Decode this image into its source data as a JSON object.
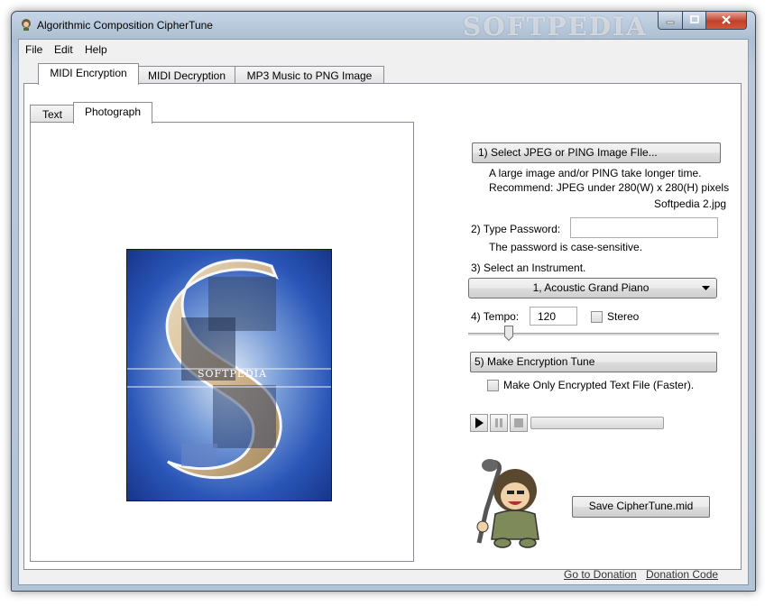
{
  "window": {
    "title": "Algorithmic Composition CipherTune",
    "watermark": "SOFTPEDIA"
  },
  "menu": {
    "file": {
      "label": "File"
    },
    "edit": {
      "label": "Edit"
    },
    "help": {
      "label": "Help"
    }
  },
  "tabs": {
    "midi_encryption": "MIDI Encryption",
    "midi_decryption": "MIDI Decryption",
    "mp3_to_png": "MP3 Music to PNG Image"
  },
  "subtabs": {
    "text": "Text",
    "photograph": "Photograph"
  },
  "photo": {
    "caption": "SOFTPEDIA"
  },
  "controls": {
    "select_image_button": "1) Select JPEG or PING Image FIle...",
    "image_hint_1": "A large image and/or PING take longer time.",
    "image_hint_2": "Recommend: JPEG under 280(W) x 280(H) pixels",
    "selected_file": "Softpedia 2.jpg",
    "password_label": "2) Type Password:",
    "password_value": "",
    "password_hint": "The password is case-sensitive.",
    "instrument_label": "3) Select an Instrument.",
    "instrument_selected": "1, Acoustic Grand Piano",
    "tempo_label": "4) Tempo:",
    "tempo_value": "120",
    "stereo_label": "Stereo",
    "stereo_checked": false,
    "tempo_slider_fraction": 0.15,
    "make_tune_button": "5) Make Encryption Tune",
    "text_only_label": "Make Only Encrypted Text File (Faster).",
    "text_only_checked": false,
    "save_button": "Save CipherTune.mid",
    "donation_link": "Go to Donation",
    "donation_code_link": "Donation Code"
  },
  "icons": {
    "play": "play-icon",
    "pause": "pause-icon",
    "stop": "stop-icon",
    "chevron": "chevron-down-icon",
    "mascot": "mascot-icon"
  },
  "colors": {
    "accent": "#2a56b8",
    "close_button": "#c0402a"
  }
}
